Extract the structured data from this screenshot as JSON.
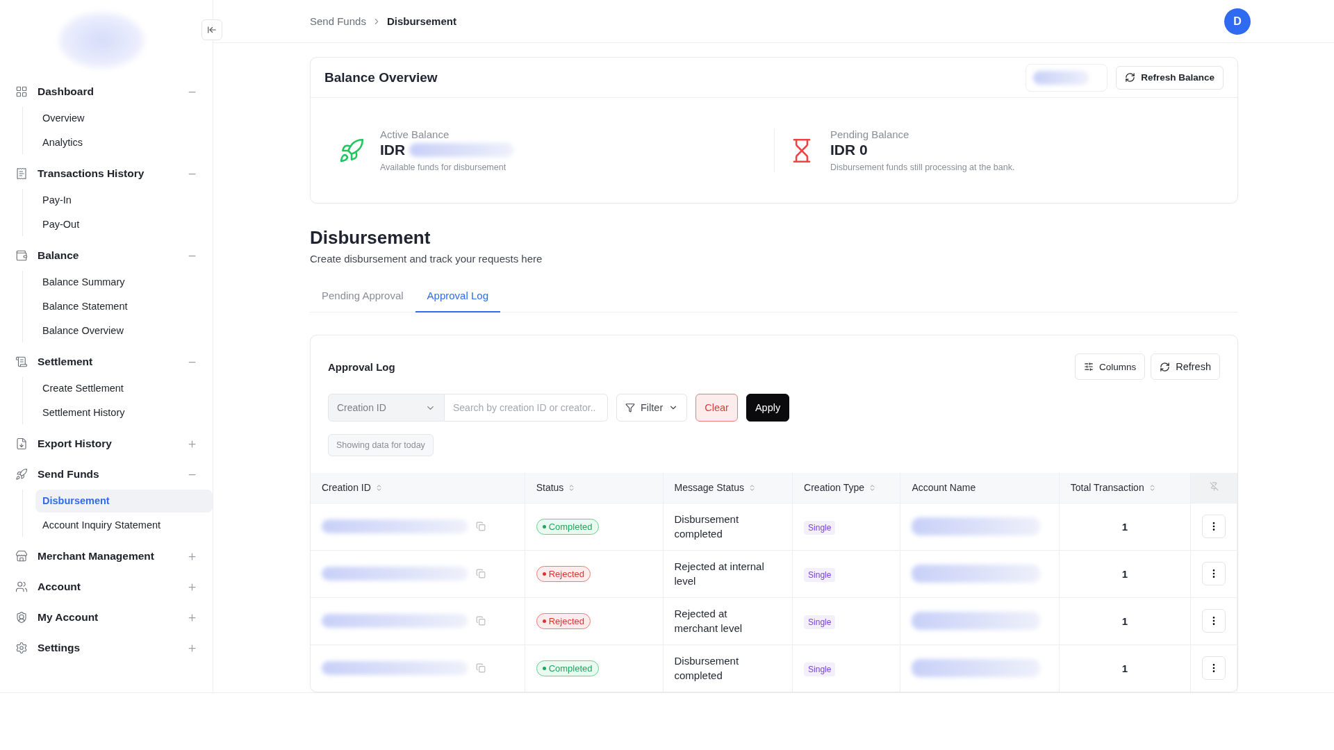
{
  "sidebar": {
    "groups": [
      {
        "label": "Dashboard",
        "expanded": true,
        "children": [
          {
            "label": "Overview",
            "selected": false
          },
          {
            "label": "Analytics",
            "selected": false
          }
        ]
      },
      {
        "label": "Transactions History",
        "expanded": true,
        "children": [
          {
            "label": "Pay-In",
            "selected": false
          },
          {
            "label": "Pay-Out",
            "selected": false
          }
        ]
      },
      {
        "label": "Balance",
        "expanded": true,
        "children": [
          {
            "label": "Balance Summary",
            "selected": false
          },
          {
            "label": "Balance Statement",
            "selected": false
          },
          {
            "label": "Balance Overview",
            "selected": false
          }
        ]
      },
      {
        "label": "Settlement",
        "expanded": true,
        "children": [
          {
            "label": "Create Settlement",
            "selected": false
          },
          {
            "label": "Settlement History",
            "selected": false
          }
        ]
      },
      {
        "label": "Export History",
        "expanded": false
      },
      {
        "label": "Send Funds",
        "expanded": true,
        "children": [
          {
            "label": "Disbursement",
            "selected": true
          },
          {
            "label": "Account Inquiry Statement",
            "selected": false
          }
        ]
      },
      {
        "label": "Merchant Management",
        "expanded": false
      },
      {
        "label": "Account",
        "expanded": false
      },
      {
        "label": "My Account",
        "expanded": false
      },
      {
        "label": "Settings",
        "expanded": false
      }
    ]
  },
  "breadcrumb": [
    "Send Funds",
    "Disbursement"
  ],
  "avatar": "D",
  "balance_overview": {
    "title": "Balance Overview",
    "refresh_button": "Refresh Balance",
    "cards": [
      {
        "label": "Active Balance",
        "amount": "IDR",
        "redacted": true,
        "note": "Available funds for disbursement",
        "kind": "active"
      },
      {
        "label": "Pending Balance",
        "amount": "IDR 0",
        "redacted": false,
        "note": "Disbursement funds still processing at the bank.",
        "kind": "pending"
      }
    ]
  },
  "page": {
    "title": "Disbursement",
    "subtitle": "Create disbursement and track your requests here"
  },
  "tabs": [
    {
      "label": "Pending Approval",
      "selected": false
    },
    {
      "label": "Approval Log",
      "selected": true
    }
  ],
  "approval_log": {
    "title": "Approval Log",
    "columns_button": "Columns",
    "refresh_button": "Refresh",
    "search_by": "Creation ID",
    "search": {
      "placeholder": "Search by creation ID or creator.."
    },
    "filter_button": "Filter",
    "clear_button": "Clear",
    "apply_button": "Apply",
    "info_chip": "Showing data for today",
    "table": {
      "columns": [
        {
          "label": "Creation ID",
          "sortable": true
        },
        {
          "label": "Status",
          "sortable": true
        },
        {
          "label": "Message Status",
          "sortable": true
        },
        {
          "label": "Creation Type",
          "sortable": true
        },
        {
          "label": "Account Name",
          "sortable": false
        },
        {
          "label": "Total Transaction",
          "sortable": true
        }
      ],
      "rows": [
        {
          "status": {
            "label": "Completed",
            "kind": "success"
          },
          "message": "Disbursement completed",
          "type": "Single",
          "total": "1"
        },
        {
          "status": {
            "label": "Rejected",
            "kind": "error"
          },
          "message": "Rejected at internal level",
          "type": "Single",
          "total": "1"
        },
        {
          "status": {
            "label": "Rejected",
            "kind": "error"
          },
          "message": "Rejected at merchant level",
          "type": "Single",
          "total": "1"
        },
        {
          "status": {
            "label": "Completed",
            "kind": "success"
          },
          "message": "Disbursement completed",
          "type": "Single",
          "total": "1"
        }
      ]
    }
  }
}
